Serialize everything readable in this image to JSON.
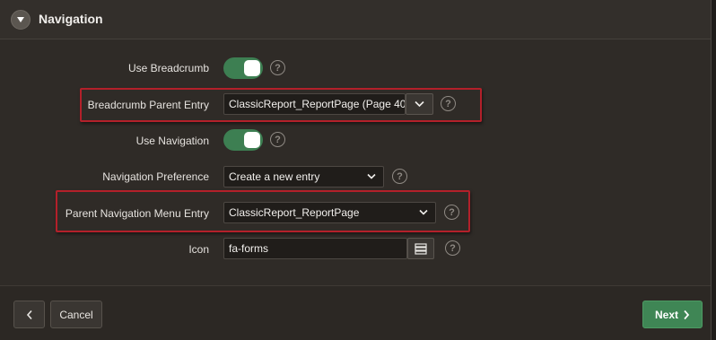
{
  "section": {
    "title": "Navigation",
    "collapse_icon": "triangle-down-icon"
  },
  "fields": {
    "use_breadcrumb": {
      "label": "Use Breadcrumb",
      "value": "on",
      "help": "?"
    },
    "breadcrumb_parent_entry": {
      "label": "Breadcrumb Parent Entry",
      "value": "ClassicReport_ReportPage (Page 40",
      "help": "?"
    },
    "use_navigation": {
      "label": "Use Navigation",
      "value": "on",
      "help": "?"
    },
    "navigation_preference": {
      "label": "Navigation Preference",
      "value": "Create a new entry",
      "help": "?"
    },
    "parent_navigation_menu_entry": {
      "label": "Parent Navigation Menu Entry",
      "value": "ClassicReport_ReportPage",
      "help": "?"
    },
    "icon": {
      "label": "Icon",
      "value": "fa-forms",
      "help": "?"
    }
  },
  "footer": {
    "cancel_label": "Cancel",
    "next_label": "Next"
  },
  "colors": {
    "toggle_on": "#3d7f52",
    "next_button": "#3f8655",
    "highlight_border": "#b3202a"
  }
}
